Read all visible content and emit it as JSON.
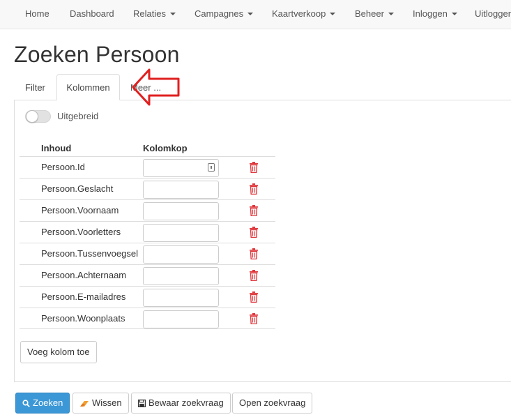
{
  "nav": {
    "items": [
      {
        "label": "Home",
        "dropdown": false
      },
      {
        "label": "Dashboard",
        "dropdown": false
      },
      {
        "label": "Relaties",
        "dropdown": true
      },
      {
        "label": "Campagnes",
        "dropdown": true
      },
      {
        "label": "Kaartverkoop",
        "dropdown": true
      },
      {
        "label": "Beheer",
        "dropdown": true
      },
      {
        "label": "Inloggen",
        "dropdown": true
      },
      {
        "label": "Uitloggen",
        "dropdown": false
      }
    ]
  },
  "page": {
    "title": "Zoeken Persoon"
  },
  "tabs": [
    {
      "label": "Filter",
      "active": false
    },
    {
      "label": "Kolommen",
      "active": true
    },
    {
      "label": "Meer ...",
      "active": false
    }
  ],
  "toggle": {
    "label": "Uitgebreid",
    "checked": false
  },
  "table": {
    "headers": {
      "inhoud": "Inhoud",
      "kolomkop": "Kolomkop"
    },
    "rows": [
      {
        "inhoud": "Persoon.Id",
        "kolomkop": ""
      },
      {
        "inhoud": "Persoon.Geslacht",
        "kolomkop": ""
      },
      {
        "inhoud": "Persoon.Voornaam",
        "kolomkop": ""
      },
      {
        "inhoud": "Persoon.Voorletters",
        "kolomkop": ""
      },
      {
        "inhoud": "Persoon.Tussenvoegsel",
        "kolomkop": ""
      },
      {
        "inhoud": "Persoon.Achternaam",
        "kolomkop": ""
      },
      {
        "inhoud": "Persoon.E-mailadres",
        "kolomkop": ""
      },
      {
        "inhoud": "Persoon.Woonplaats",
        "kolomkop": ""
      }
    ]
  },
  "buttons": {
    "add_column": "Voeg kolom toe",
    "search": "Zoeken",
    "clear": "Wissen",
    "save_query": "Bewaar zoekvraag",
    "open_query": "Open zoekvraag"
  },
  "colors": {
    "primary": "#3c97d6",
    "delete": "#e0393e",
    "annotation_arrow": "#e02020",
    "eraser": "#f0a030"
  },
  "icons": {
    "search": "search-icon",
    "clear": "eraser-icon",
    "save": "floppy-disk-icon",
    "delete": "trash-icon",
    "input_badge": "contact-card-icon"
  }
}
